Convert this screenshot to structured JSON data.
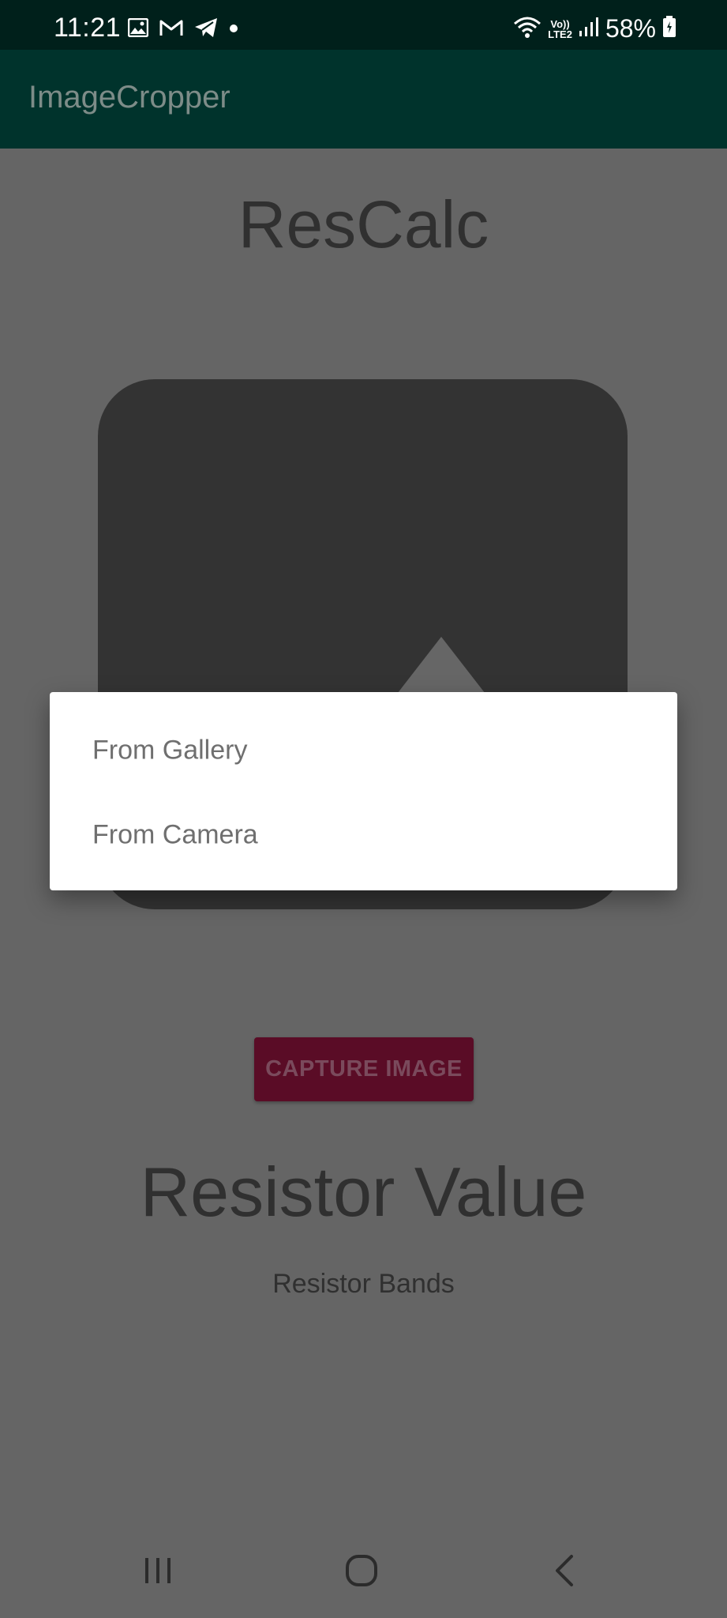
{
  "status_bar": {
    "time": "11:21",
    "battery": "58%",
    "network_label_top": "Vo))",
    "network_label_bottom": "LTE2",
    "notification_icons": [
      "gallery-icon",
      "gmail-icon",
      "telegram-icon",
      "dot-icon"
    ],
    "system_icons": [
      "wifi-icon",
      "volte-icon",
      "signal-icon",
      "battery-icon"
    ]
  },
  "app_bar": {
    "title": "ImageCropper"
  },
  "main": {
    "title": "ResCalc",
    "capture_button_label": "CAPTURE IMAGE",
    "resistor_value": "Resistor Value",
    "resistor_bands": "Resistor Bands"
  },
  "dialog": {
    "items": [
      {
        "label": "From Gallery"
      },
      {
        "label": "From Camera"
      }
    ]
  },
  "nav_bar": {
    "buttons": [
      "recents-icon",
      "home-icon",
      "back-icon"
    ]
  },
  "colors": {
    "status_bar_bg": "#00201b",
    "app_bar_bg": "#00332c",
    "scrim_content": "#656565",
    "image_placeholder": "#333333",
    "capture_button_bg": "#5a0c26",
    "dialog_bg": "#ffffff"
  }
}
